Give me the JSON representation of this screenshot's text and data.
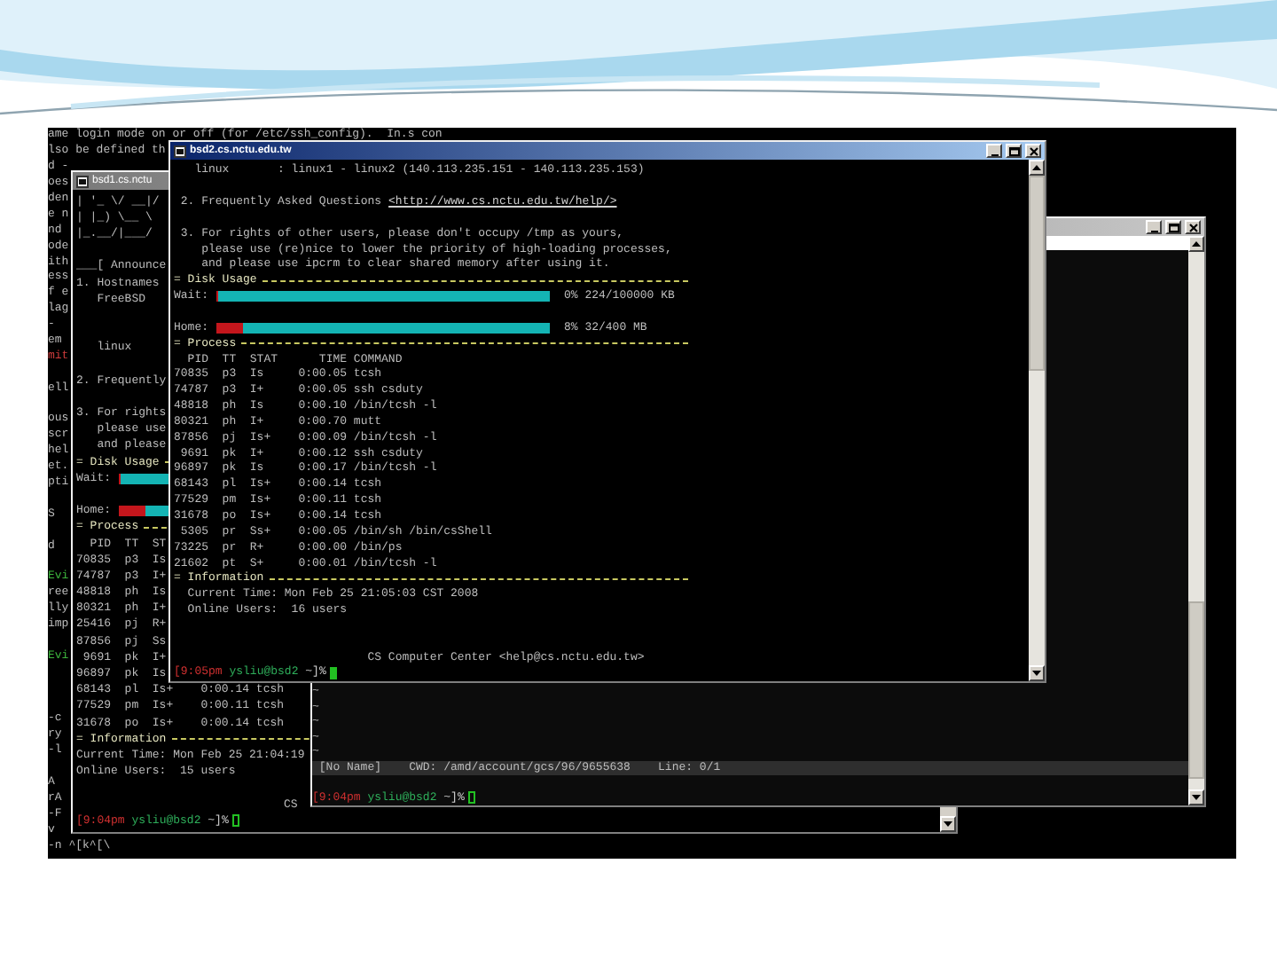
{
  "background_terminal": {
    "lines": [
      {
        "kind": "text",
        "text": "ame login mode on or off (for /etc/ssh_config).  In.s con"
      },
      {
        "kind": "text",
        "text": "lso be defined th"
      },
      {
        "kind": "text",
        "text": "d -"
      },
      {
        "kind": "text",
        "text": "oes"
      },
      {
        "kind": "text",
        "text": "den"
      },
      {
        "kind": "text",
        "text": "e n"
      },
      {
        "kind": "text",
        "text": "nd"
      },
      {
        "kind": "text",
        "text": "ode"
      },
      {
        "kind": "text",
        "text": "ith"
      },
      {
        "kind": "text",
        "text": "ess"
      },
      {
        "kind": "text",
        "text": "f e"
      },
      {
        "kind": "text",
        "text": "lag"
      },
      {
        "kind": "text",
        "text": "-"
      },
      {
        "kind": "text",
        "text": "em"
      },
      {
        "kind": "text",
        "text": "mit",
        "color": "#d03c3c"
      },
      {
        "kind": "blank"
      },
      {
        "kind": "text",
        "text": "ell"
      },
      {
        "kind": "blank"
      },
      {
        "kind": "text",
        "text": "ous"
      },
      {
        "kind": "text",
        "text": "scr"
      },
      {
        "kind": "text",
        "text": "hel"
      },
      {
        "kind": "text",
        "text": "et."
      },
      {
        "kind": "text",
        "text": "pti"
      },
      {
        "kind": "blank"
      },
      {
        "kind": "text",
        "text": "S"
      },
      {
        "kind": "blank"
      },
      {
        "kind": "text",
        "text": "d"
      },
      {
        "kind": "blank"
      },
      {
        "kind": "text",
        "text": "Evi",
        "color": "#3cb43c"
      },
      {
        "kind": "text",
        "text": "ree"
      },
      {
        "kind": "text",
        "text": "lly"
      },
      {
        "kind": "text",
        "text": "imp"
      },
      {
        "kind": "blank"
      },
      {
        "kind": "text",
        "text": "Evi",
        "color": "#3cb43c"
      },
      {
        "kind": "blank"
      },
      {
        "kind": "blank"
      },
      {
        "kind": "blank"
      },
      {
        "kind": "text",
        "text": "-c"
      },
      {
        "kind": "text",
        "text": "ry"
      },
      {
        "kind": "text",
        "text": "-l"
      },
      {
        "kind": "blank"
      },
      {
        "kind": "text",
        "text": "A"
      },
      {
        "kind": "text",
        "text": "rA"
      },
      {
        "kind": "text",
        "text": "-F"
      },
      {
        "kind": "text",
        "text": "v"
      },
      {
        "kind": "text",
        "text": "-n ^[k^[\\"
      }
    ]
  },
  "windows": [
    {
      "kind": "terminal",
      "title": "bsd1.cs.nctu",
      "active": false,
      "lines": [
        {
          "kind": "text",
          "text": "| '_ \\/ __|/"
        },
        {
          "kind": "text",
          "text": "| |_) \\__ \\"
        },
        {
          "kind": "text",
          "text": "|_.__/|___/"
        },
        {
          "kind": "blank"
        },
        {
          "kind": "text",
          "text": "___[ Announce"
        },
        {
          "kind": "text",
          "text": "1. Hostnames"
        },
        {
          "kind": "text",
          "text": "   FreeBSD"
        },
        {
          "kind": "blank"
        },
        {
          "kind": "blank"
        },
        {
          "kind": "text",
          "text": "   linux"
        },
        {
          "kind": "blank"
        },
        {
          "kind": "text",
          "text": "2. Frequently"
        },
        {
          "kind": "blank"
        },
        {
          "kind": "text",
          "text": "3. For rights"
        },
        {
          "kind": "text",
          "text": "   please use"
        },
        {
          "kind": "text",
          "text": "   and please"
        },
        {
          "kind": "rule",
          "text": "= Disk Usage"
        },
        {
          "kind": "bar",
          "label": "Wait:",
          "level": 0.002
        },
        {
          "kind": "blank"
        },
        {
          "kind": "bar",
          "label": "Home:",
          "level": 0.08
        },
        {
          "kind": "rule",
          "text": "= Process"
        },
        {
          "kind": "text",
          "text": "  PID  TT  ST"
        },
        {
          "kind": "text",
          "text": "70835  p3  Is"
        },
        {
          "kind": "text",
          "text": "74787  p3  I+"
        },
        {
          "kind": "text",
          "text": "48818  ph  Is"
        },
        {
          "kind": "text",
          "text": "80321  ph  I+"
        },
        {
          "kind": "text",
          "text": "25416  pj  R+"
        },
        {
          "kind": "text",
          "text": "87856  pj  Ss"
        },
        {
          "kind": "text",
          "text": " 9691  pk  I+"
        },
        {
          "kind": "text",
          "text": "96897  pk  Is"
        },
        {
          "kind": "text",
          "text": "68143  pl  Is+    0:00.14 tcsh"
        },
        {
          "kind": "text",
          "text": "77529  pm  Is+    0:00.11 tcsh"
        },
        {
          "kind": "text",
          "text": "31678  po  Is+    0:00.14 tcsh"
        },
        {
          "kind": "rule",
          "text": "= Information"
        },
        {
          "kind": "text",
          "text": "Current Time: Mon Feb 25 21:04:19"
        },
        {
          "kind": "text",
          "text": "Online Users:  15 users"
        },
        {
          "kind": "blank"
        },
        {
          "kind": "text",
          "text": "                              CS"
        },
        {
          "kind": "prompt",
          "time": "[9:04pm",
          "user": "ysliu@bsd2",
          "path": "~]%",
          "cursor_solid": false
        }
      ]
    },
    {
      "kind": "editor",
      "active": false,
      "lines": [
        {
          "kind": "text",
          "text": "~"
        },
        {
          "kind": "text",
          "text": "~"
        },
        {
          "kind": "text",
          "text": "~"
        },
        {
          "kind": "text",
          "text": "~"
        },
        {
          "kind": "text",
          "text": "~"
        },
        {
          "kind": "status",
          "text": " [No Name]    CWD: /amd/account/gcs/96/9655638    Line: 0/1"
        },
        {
          "kind": "blank"
        },
        {
          "kind": "prompt",
          "time": "[9:04pm",
          "user": "ysliu@bsd2",
          "path": "~]%",
          "cursor_solid": false
        }
      ]
    },
    {
      "kind": "terminal",
      "title": "bsd2.cs.nctu.edu.tw",
      "active": true,
      "lines": [
        {
          "kind": "text",
          "text": "   linux       : linux1 - linux2 (140.113.235.151 - 140.113.235.153)"
        },
        {
          "kind": "blank"
        },
        {
          "kind": "link",
          "text": " 2. Frequently Asked Questions",
          "link": "<http://www.cs.nctu.edu.tw/help/>"
        },
        {
          "kind": "blank"
        },
        {
          "kind": "text",
          "text": " 3. For rights of other users, please don't occupy /tmp as yours,"
        },
        {
          "kind": "text",
          "text": "    please use (re)nice to lower the priority of high-loading processes,"
        },
        {
          "kind": "text",
          "text": "    and please use ipcrm to clear shared memory after using it."
        },
        {
          "kind": "rule",
          "text": "= Disk Usage"
        },
        {
          "kind": "bar",
          "label": "Wait:",
          "level": 0.002,
          "reading": "0% 224/100000 KB"
        },
        {
          "kind": "blank"
        },
        {
          "kind": "bar",
          "label": "Home:",
          "level": 0.08,
          "reading": "8% 32/400 MB"
        },
        {
          "kind": "rule",
          "text": "= Process"
        },
        {
          "kind": "text",
          "text": "  PID  TT  STAT      TIME COMMAND"
        },
        {
          "kind": "text",
          "text": "70835  p3  Is     0:00.05 tcsh"
        },
        {
          "kind": "text",
          "text": "74787  p3  I+     0:00.05 ssh csduty"
        },
        {
          "kind": "text",
          "text": "48818  ph  Is     0:00.10 /bin/tcsh -l"
        },
        {
          "kind": "text",
          "text": "80321  ph  I+     0:00.70 mutt"
        },
        {
          "kind": "text",
          "text": "87856  pj  Is+    0:00.09 /bin/tcsh -l"
        },
        {
          "kind": "text",
          "text": " 9691  pk  I+     0:00.12 ssh csduty"
        },
        {
          "kind": "text",
          "text": "96897  pk  Is     0:00.17 /bin/tcsh -l"
        },
        {
          "kind": "text",
          "text": "68143  pl  Is+    0:00.14 tcsh"
        },
        {
          "kind": "text",
          "text": "77529  pm  Is+    0:00.11 tcsh"
        },
        {
          "kind": "text",
          "text": "31678  po  Is+    0:00.14 tcsh"
        },
        {
          "kind": "text",
          "text": " 5305  pr  Ss+    0:00.05 /bin/sh /bin/csShell"
        },
        {
          "kind": "text",
          "text": "73225  pr  R+     0:00.00 /bin/ps"
        },
        {
          "kind": "text",
          "text": "21602  pt  S+     0:00.01 /bin/tcsh -l"
        },
        {
          "kind": "rule",
          "text": "= Information"
        },
        {
          "kind": "text",
          "text": "  Current Time: Mon Feb 25 21:05:03 CST 2008"
        },
        {
          "kind": "text",
          "text": "  Online Users:  16 users"
        },
        {
          "kind": "blank"
        },
        {
          "kind": "blank"
        },
        {
          "kind": "text",
          "text": "                            CS Computer Center <help@cs.nctu.edu.tw>"
        },
        {
          "kind": "prompt",
          "time": "[9:05pm",
          "user": "ysliu@bsd2",
          "path": "~]%",
          "cursor_solid": true
        }
      ]
    }
  ]
}
